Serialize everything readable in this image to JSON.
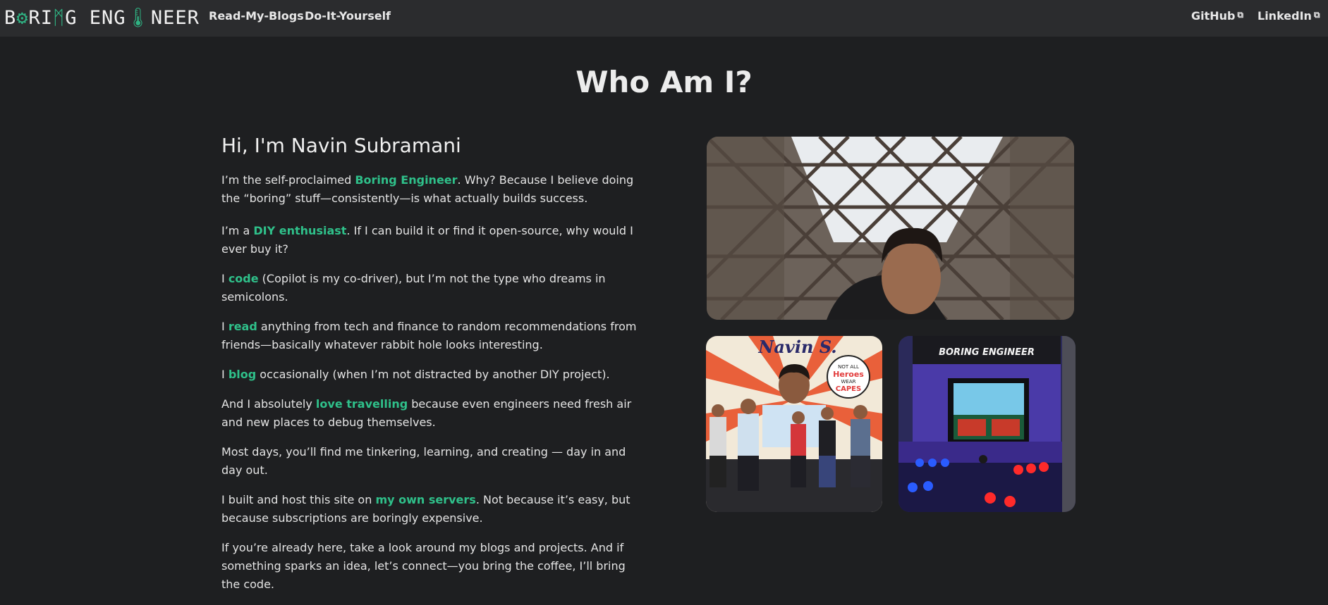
{
  "nav": {
    "logo_text_1": "B",
    "logo_text_2": "RI",
    "logo_text_3": "G ENG",
    "logo_text_4": "NEER",
    "links": [
      "Read-My-Blogs",
      "Do-It-Yourself"
    ],
    "github": "GitHub",
    "linkedin": "LinkedIn"
  },
  "page": {
    "title": "Who Am I?"
  },
  "bio": {
    "heading": "Hi, I'm Navin Subramani",
    "p1_a": "I’m the self-proclaimed ",
    "p1_hl": "Boring Engineer",
    "p1_b": ". Why? Because I believe doing the “boring” stuff—consistently—is what actually builds success.",
    "p2_a": "I’m a ",
    "p2_hl": "DIY enthusiast",
    "p2_b": ". If I can build it or find it open-source, why would I ever buy it?",
    "p3_a": "I ",
    "p3_hl": "code",
    "p3_b": " (Copilot is my co-driver), but I’m not the type who dreams in semicolons.",
    "p4_a": "I ",
    "p4_hl": "read",
    "p4_b": " anything from tech and finance to random recommendations from friends—basically whatever rabbit hole looks interesting.",
    "p5_a": "I ",
    "p5_hl": "blog",
    "p5_b": " occasionally (when I’m not distracted by another DIY project).",
    "p6_a": "And I absolutely ",
    "p6_hl": "love travelling",
    "p6_b": " because even engineers need fresh air and new places to debug themselves.",
    "p7": "Most days, you’ll find me tinkering, learning, and creating — day in and day out.",
    "p8_a": "I built and host this site on ",
    "p8_hl": "my own servers",
    "p8_b": ". Not because it’s easy, but because subscriptions are boringly expensive.",
    "p9": "If you’re already here, take a look around my blogs and projects. And if something sparks an idea, let’s connect—you bring the coffee, I’ll bring the code."
  },
  "photos": {
    "stage_banner": "Navin S.",
    "stage_badge_1": "NOT ALL",
    "stage_badge_2": "Heroes",
    "stage_badge_3": "WEAR",
    "stage_badge_4": "CAPES",
    "arcade_marquee": "BORING ENGINEER"
  },
  "colors": {
    "accent": "#2fc08a",
    "background": "#1e1f21",
    "navbar": "#2b2c2e"
  }
}
